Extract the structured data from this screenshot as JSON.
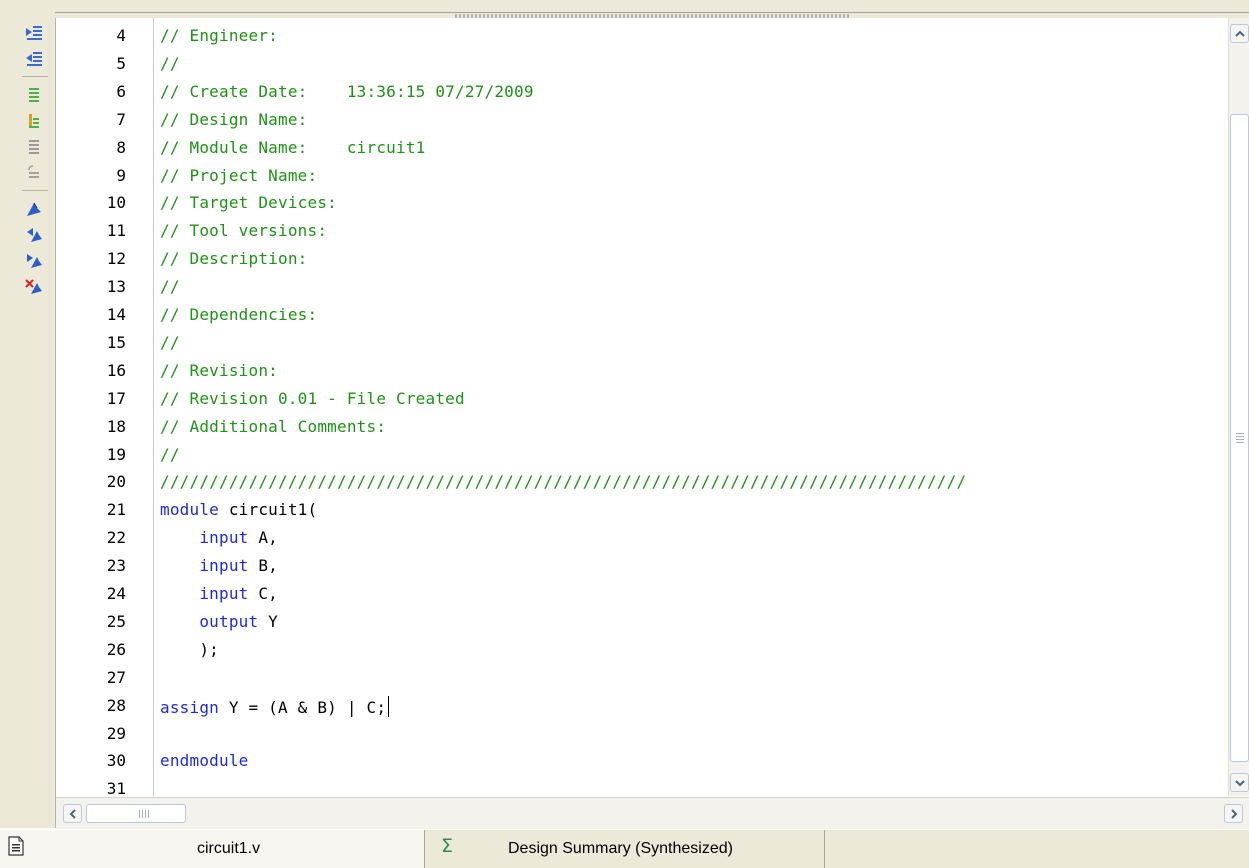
{
  "editor": {
    "file_name": "circuit1.v",
    "line_numbers": [
      "4",
      "5",
      "6",
      "7",
      "8",
      "9",
      "10",
      "11",
      "12",
      "13",
      "14",
      "15",
      "16",
      "17",
      "18",
      "19",
      "20",
      "21",
      "22",
      "23",
      "24",
      "25",
      "26",
      "27",
      "28",
      "29",
      "30",
      "31"
    ],
    "lines": [
      [
        {
          "t": "// Engineer:",
          "s": "comment"
        }
      ],
      [
        {
          "t": "//",
          "s": "comment"
        }
      ],
      [
        {
          "t": "// Create Date:    13:36:15 07/27/2009",
          "s": "comment"
        }
      ],
      [
        {
          "t": "// Design Name:",
          "s": "comment"
        }
      ],
      [
        {
          "t": "// Module Name:    circuit1",
          "s": "comment"
        }
      ],
      [
        {
          "t": "// Project Name:",
          "s": "comment"
        }
      ],
      [
        {
          "t": "// Target Devices:",
          "s": "comment"
        }
      ],
      [
        {
          "t": "// Tool versions:",
          "s": "comment"
        }
      ],
      [
        {
          "t": "// Description:",
          "s": "comment"
        }
      ],
      [
        {
          "t": "//",
          "s": "comment"
        }
      ],
      [
        {
          "t": "// Dependencies:",
          "s": "comment"
        }
      ],
      [
        {
          "t": "//",
          "s": "comment"
        }
      ],
      [
        {
          "t": "// Revision:",
          "s": "comment"
        }
      ],
      [
        {
          "t": "// Revision 0.01 - File Created",
          "s": "comment"
        }
      ],
      [
        {
          "t": "// Additional Comments:",
          "s": "comment"
        }
      ],
      [
        {
          "t": "//",
          "s": "comment"
        }
      ],
      [
        {
          "t": "//////////////////////////////////////////////////////////////////////////////////",
          "s": "comment"
        }
      ],
      [
        {
          "t": "module",
          "s": "kw"
        },
        {
          "t": " circuit1(",
          "s": "plain"
        }
      ],
      [
        {
          "t": "    ",
          "s": "plain"
        },
        {
          "t": "input",
          "s": "kw"
        },
        {
          "t": " A,",
          "s": "plain"
        }
      ],
      [
        {
          "t": "    ",
          "s": "plain"
        },
        {
          "t": "input",
          "s": "kw"
        },
        {
          "t": " B,",
          "s": "plain"
        }
      ],
      [
        {
          "t": "    ",
          "s": "plain"
        },
        {
          "t": "input",
          "s": "kw"
        },
        {
          "t": " C,",
          "s": "plain"
        }
      ],
      [
        {
          "t": "    ",
          "s": "plain"
        },
        {
          "t": "output",
          "s": "kw"
        },
        {
          "t": " Y",
          "s": "plain"
        }
      ],
      [
        {
          "t": "    );",
          "s": "plain"
        }
      ],
      [
        {
          "t": "",
          "s": "plain"
        }
      ],
      [
        {
          "t": "assign",
          "s": "kw"
        },
        {
          "t": " Y = (A & B) | C;",
          "s": "plain"
        }
      ],
      [
        {
          "t": "",
          "s": "plain"
        }
      ],
      [
        {
          "t": "endmodule",
          "s": "kw"
        }
      ],
      [
        {
          "t": "",
          "s": "plain"
        }
      ]
    ],
    "caret_line": 24
  },
  "toolbar": {
    "buttons": [
      "indent-icon",
      "unindent-icon",
      "comment-lines-icon",
      "uncomment-lines-icon",
      "toggle-comment-icon",
      "undo-comment-icon",
      "bookmark-icon",
      "next-bookmark-icon",
      "previous-bookmark-icon",
      "clear-bookmarks-icon"
    ]
  },
  "tabs": [
    {
      "label": "circuit1.v",
      "icon": "document-icon"
    },
    {
      "label": "Design Summary (Synthesized)",
      "icon": "sigma-icon"
    }
  ],
  "colors": {
    "comment": "#1d9314",
    "keyword": "#1b2ae0",
    "text": "#000000",
    "chrome": "#ece9d8"
  }
}
